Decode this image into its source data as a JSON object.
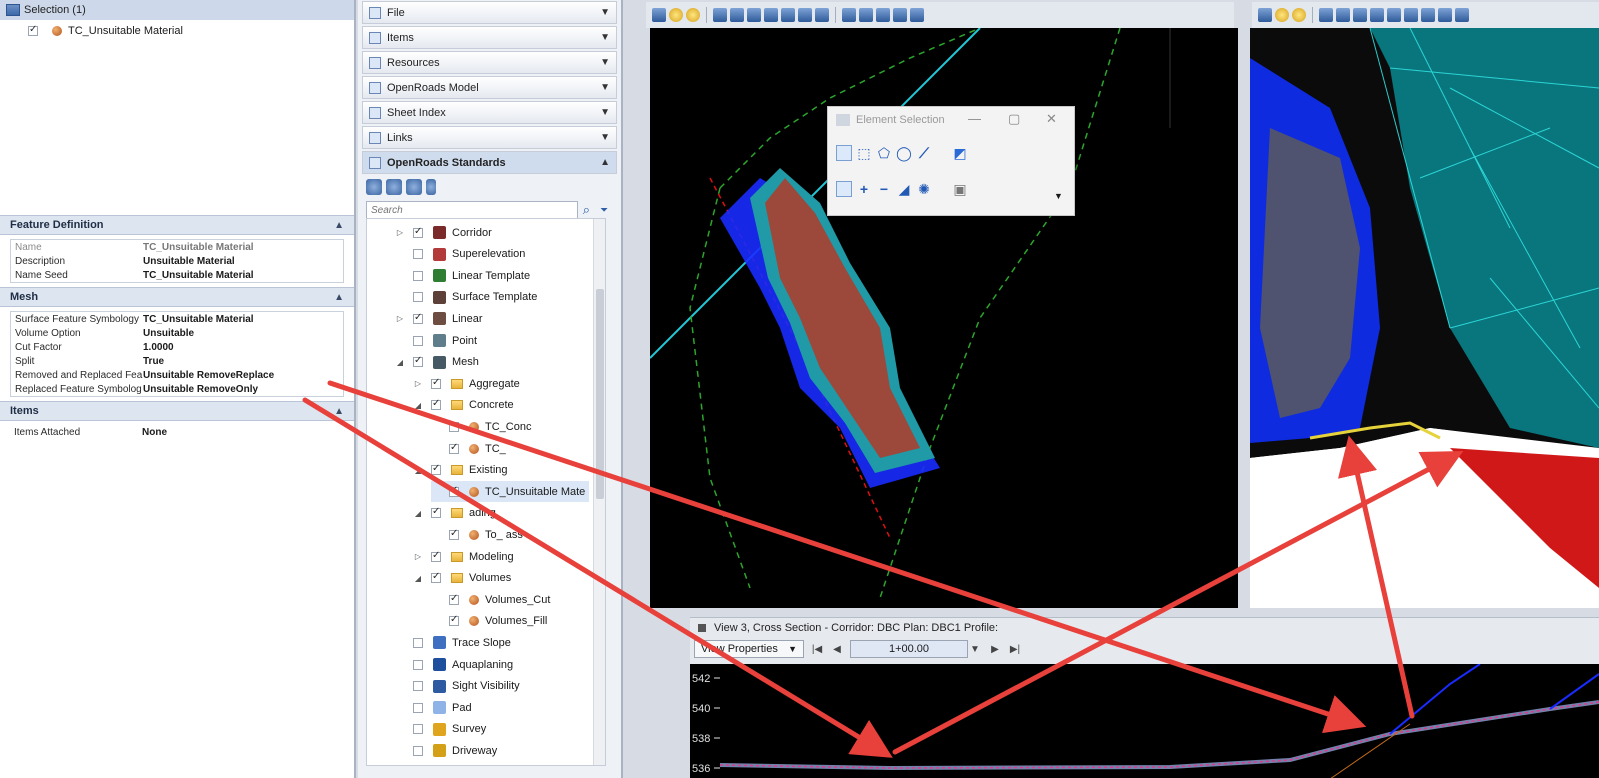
{
  "selection": {
    "header": "Selection (1)",
    "item": "TC_Unsuitable Material"
  },
  "feature_definition": {
    "title": "Feature Definition",
    "rows": [
      {
        "key": "Name",
        "value": "TC_Unsuitable Material",
        "dim": true
      },
      {
        "key": "Description",
        "value": "Unsuitable Material",
        "dim": false
      },
      {
        "key": "Name Seed",
        "value": "TC_Unsuitable Material",
        "dim": false
      }
    ]
  },
  "mesh": {
    "title": "Mesh",
    "rows": [
      {
        "key": "Surface Feature Symbology",
        "value": "TC_Unsuitable Material"
      },
      {
        "key": "Volume Option",
        "value": "Unsuitable"
      },
      {
        "key": "Cut Factor",
        "value": "1.0000"
      },
      {
        "key": "Split",
        "value": "True"
      },
      {
        "key": "Removed and Replaced Fea",
        "value": "Unsuitable RemoveReplace"
      },
      {
        "key": "Replaced Feature Symbolog",
        "value": "Unsuitable RemoveOnly"
      }
    ]
  },
  "items_section": {
    "title": "Items",
    "rows": [
      {
        "key": "Items Attached",
        "value": "None"
      }
    ]
  },
  "explorer": {
    "sections": [
      "File",
      "Items",
      "Resources",
      "OpenRoads Model",
      "Sheet Index",
      "Links"
    ],
    "active_section": "OpenRoads Standards",
    "search_placeholder": "Search",
    "tree": [
      {
        "label": "Corridor",
        "indent": 0,
        "twisty": "▷",
        "checked": true,
        "icon": "corridor"
      },
      {
        "label": "Superelevation",
        "indent": 0,
        "twisty": "",
        "checked": false,
        "icon": "super"
      },
      {
        "label": "Linear Template",
        "indent": 0,
        "twisty": "",
        "checked": false,
        "icon": "lintemp"
      },
      {
        "label": "Surface Template",
        "indent": 0,
        "twisty": "",
        "checked": false,
        "icon": "surftemp"
      },
      {
        "label": "Linear",
        "indent": 0,
        "twisty": "▷",
        "checked": true,
        "icon": "linear"
      },
      {
        "label": "Point",
        "indent": 0,
        "twisty": "",
        "checked": false,
        "icon": "point"
      },
      {
        "label": "Mesh",
        "indent": 0,
        "twisty": "◢",
        "checked": true,
        "icon": "mesh"
      },
      {
        "label": "Aggregate",
        "indent": 1,
        "twisty": "▷",
        "checked": true,
        "icon": "folder"
      },
      {
        "label": "Concrete",
        "indent": 1,
        "twisty": "◢",
        "checked": true,
        "icon": "folder"
      },
      {
        "label": "TC_Conc",
        "indent": 2,
        "twisty": "",
        "checked": false,
        "icon": "mat"
      },
      {
        "label": "TC_",
        "indent": 2,
        "twisty": "",
        "checked": true,
        "icon": "mat"
      },
      {
        "label": "Existing",
        "indent": 1,
        "twisty": "◢",
        "checked": true,
        "icon": "folder"
      },
      {
        "label": "TC_Unsuitable Mate",
        "indent": 2,
        "twisty": "",
        "checked": true,
        "icon": "mat",
        "selected": true
      },
      {
        "label": "ading",
        "indent": 1,
        "twisty": "◢",
        "checked": true,
        "icon": "folder"
      },
      {
        "label": "To_ ass",
        "indent": 2,
        "twisty": "",
        "checked": true,
        "icon": "mat"
      },
      {
        "label": "Modeling",
        "indent": 1,
        "twisty": "▷",
        "checked": true,
        "icon": "folder"
      },
      {
        "label": "Volumes",
        "indent": 1,
        "twisty": "◢",
        "checked": true,
        "icon": "folder"
      },
      {
        "label": "Volumes_Cut",
        "indent": 2,
        "twisty": "",
        "checked": true,
        "icon": "mat"
      },
      {
        "label": "Volumes_Fill",
        "indent": 2,
        "twisty": "",
        "checked": true,
        "icon": "mat"
      },
      {
        "label": "Trace Slope",
        "indent": 0,
        "twisty": "",
        "checked": false,
        "icon": "trace"
      },
      {
        "label": "Aquaplaning",
        "indent": 0,
        "twisty": "",
        "checked": false,
        "icon": "aqua"
      },
      {
        "label": "Sight Visibility",
        "indent": 0,
        "twisty": "",
        "checked": false,
        "icon": "sight"
      },
      {
        "label": "Pad",
        "indent": 0,
        "twisty": "",
        "checked": false,
        "icon": "pad"
      },
      {
        "label": "Survey",
        "indent": 0,
        "twisty": "",
        "checked": false,
        "icon": "survey"
      },
      {
        "label": "Driveway",
        "indent": 0,
        "twisty": "",
        "checked": false,
        "icon": "drive"
      }
    ]
  },
  "element_selection": {
    "title": "Element Selection"
  },
  "cross_section": {
    "title": "View 3, Cross Section - Corridor: DBC Plan: DBC1 Profile:",
    "view_properties": "View Properties",
    "station": "1+00.00",
    "y_ticks": [
      "542",
      "540",
      "538",
      "536"
    ]
  },
  "colors": {
    "accent_blue": "#2f5b9a",
    "arrow_red": "#e8403a",
    "mesh_cyan": "#2ad6d6",
    "mesh_blue": "#1a2bff"
  }
}
